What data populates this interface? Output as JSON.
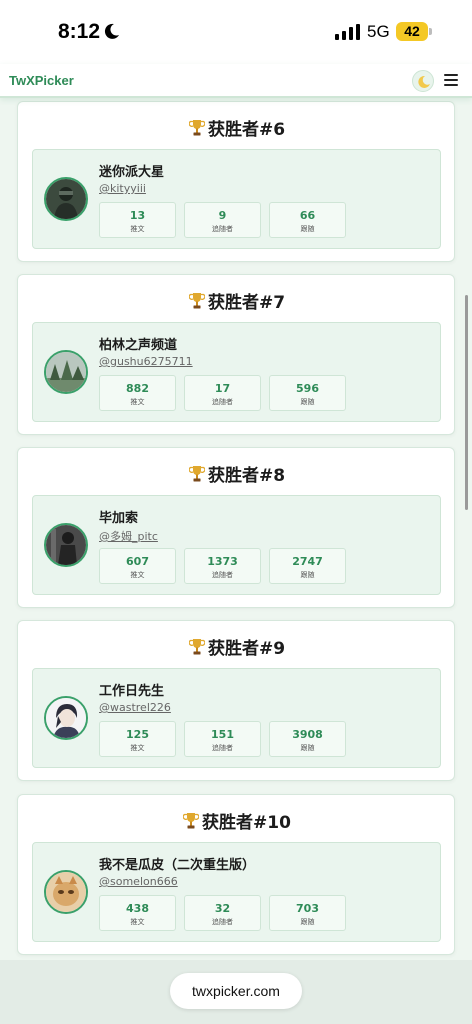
{
  "status_bar": {
    "time": "8:12",
    "network": "5G",
    "battery": "42"
  },
  "header": {
    "brand": "TwXPicker"
  },
  "winners": [
    {
      "title": "获胜者#6",
      "name": "迷你派大星",
      "handle": "@kityyiii",
      "tweets": "13",
      "followers": "9",
      "following": "66"
    },
    {
      "title": "获胜者#7",
      "name": "柏林之声频道",
      "handle": "@gushu6275711",
      "tweets": "882",
      "followers": "17",
      "following": "596"
    },
    {
      "title": "获胜者#8",
      "name": "毕加索",
      "handle": "@多姆_pitc",
      "tweets": "607",
      "followers": "1373",
      "following": "2747"
    },
    {
      "title": "获胜者#9",
      "name": "工作日先生",
      "handle": "@wastrel226",
      "tweets": "125",
      "followers": "151",
      "following": "3908"
    },
    {
      "title": "获胜者#10",
      "name": "我不是瓜皮（二次重生版）",
      "handle": "@somelon666",
      "tweets": "438",
      "followers": "32",
      "following": "703"
    }
  ],
  "stat_labels": {
    "tweets": "推文",
    "followers": "追随者",
    "following": "跟随"
  },
  "browser": {
    "url": "twxpicker.com"
  },
  "colors": {
    "accent": "#2e8b57",
    "background": "#eef6f0",
    "card": "#ffffff"
  }
}
